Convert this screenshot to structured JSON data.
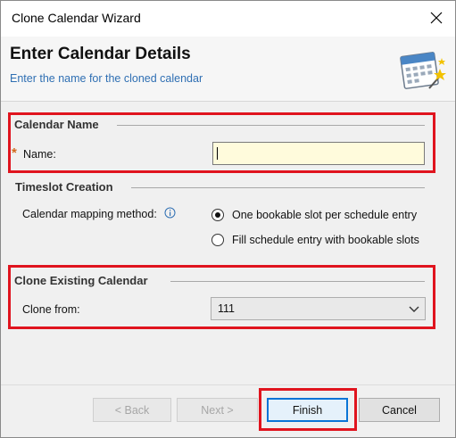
{
  "window": {
    "title": "Clone Calendar Wizard"
  },
  "header": {
    "title": "Enter Calendar Details",
    "subtitle": "Enter the name for the cloned calendar",
    "icon": "calendar-wizard-icon"
  },
  "calendar_name": {
    "group_title": "Calendar Name",
    "required_marker": "*",
    "name_label": "Name:",
    "name_value": ""
  },
  "timeslot": {
    "group_title": "Timeslot Creation",
    "mapping_label": "Calendar mapping method:",
    "options": [
      {
        "label": "One bookable slot per schedule entry",
        "selected": true
      },
      {
        "label": "Fill schedule entry with bookable slots",
        "selected": false
      }
    ]
  },
  "clone_existing": {
    "group_title": "Clone Existing Calendar",
    "clone_from_label": "Clone from:",
    "clone_from_value": "111"
  },
  "buttons": {
    "back": "< Back",
    "next": "Next >",
    "finish": "Finish",
    "cancel": "Cancel"
  },
  "highlight_color": "#e0141e"
}
